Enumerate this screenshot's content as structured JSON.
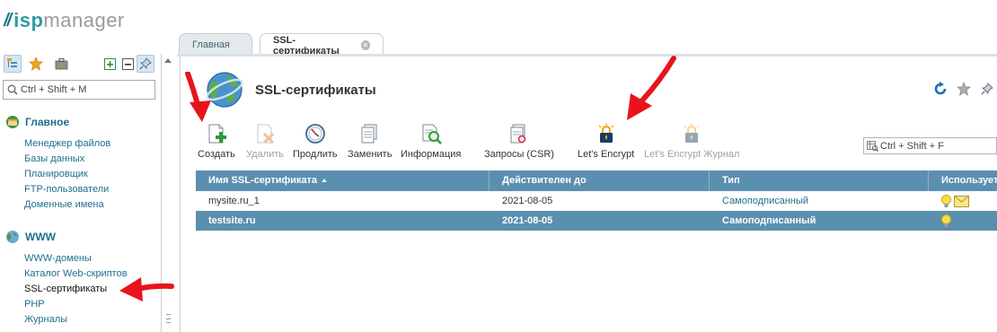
{
  "app": {
    "logo_isp": "isp",
    "logo_manager": "manager"
  },
  "left": {
    "search_placeholder": "Ctrl + Shift + M",
    "sections": [
      {
        "title": "Главное",
        "items": [
          "Менеджер файлов",
          "Базы данных",
          "Планировщик",
          "FTP-пользователи",
          "Доменные имена"
        ]
      },
      {
        "title": "WWW",
        "items": [
          "WWW-домены",
          "Каталог Web-скриптов",
          "SSL-сертификаты",
          "PHP",
          "Журналы"
        ]
      }
    ]
  },
  "tabs": [
    {
      "label": "Главная"
    },
    {
      "label": "SSL-сертификаты"
    }
  ],
  "page": {
    "title": "SSL-сертификаты"
  },
  "toolbar": {
    "buttons": [
      {
        "label": "Создать",
        "icon": "create-icon",
        "enabled": true
      },
      {
        "label": "Удалить",
        "icon": "delete-icon",
        "enabled": false
      },
      {
        "label": "Продлить",
        "icon": "renew-icon",
        "enabled": true
      },
      {
        "label": "Заменить",
        "icon": "replace-icon",
        "enabled": true
      },
      {
        "label": "Информация",
        "icon": "info-icon",
        "enabled": true
      },
      {
        "label": "Запросы (CSR)",
        "icon": "csr-icon",
        "enabled": true
      },
      {
        "label": "Let's Encrypt",
        "icon": "lets-encrypt-icon",
        "enabled": true
      },
      {
        "label": "Let's Encrypt Журнал",
        "icon": "lets-encrypt-log-icon",
        "enabled": false
      }
    ],
    "search_placeholder": "Ctrl + Shift + F"
  },
  "table": {
    "columns": [
      "Имя SSL-сертификата",
      "Действителен до",
      "Тип",
      "Используется"
    ],
    "rows": [
      {
        "name": "mysite.ru_1",
        "valid_until": "2021-08-05",
        "type": "Самоподписанный",
        "selected": false
      },
      {
        "name": "testsite.ru",
        "valid_until": "2021-08-05",
        "type": "Самоподписанный",
        "selected": true
      }
    ]
  },
  "colors": {
    "accent": "#5b8fb0",
    "link": "#1e6f8c",
    "annotation": "#e8141b"
  }
}
